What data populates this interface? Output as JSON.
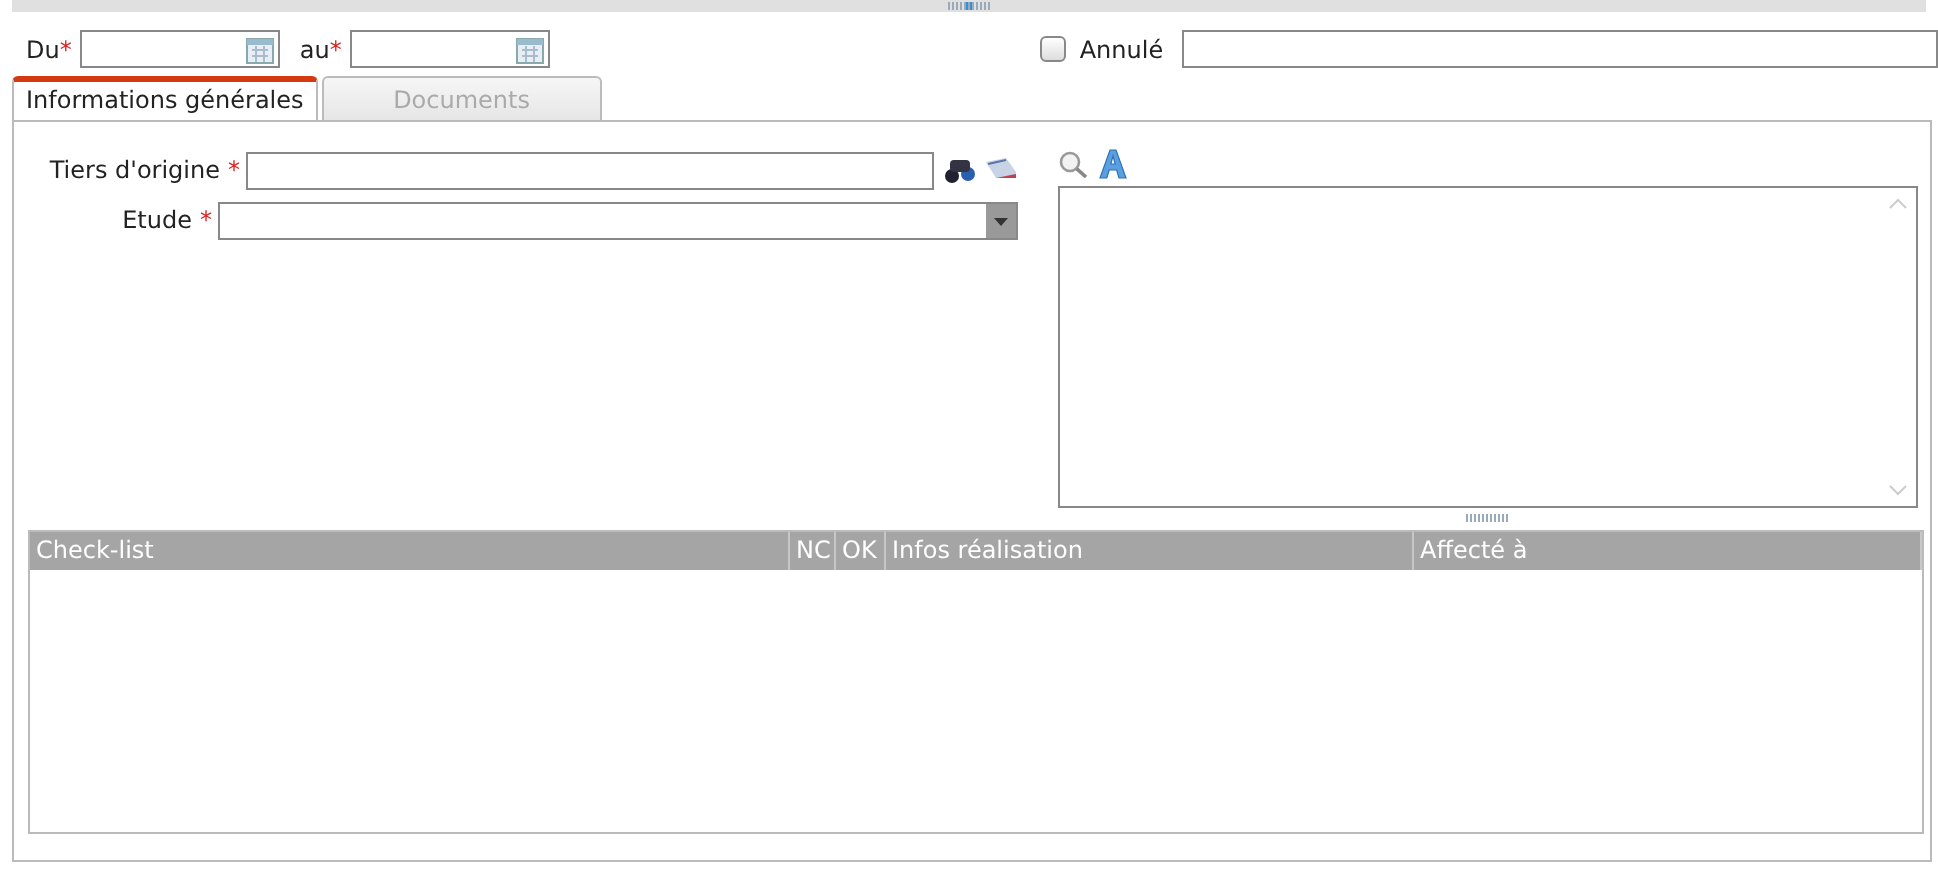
{
  "dates": [
    {
      "label": "Du",
      "required_mark": "*"
    },
    {
      "label": "au",
      "required_mark": "*"
    }
  ],
  "cancelled": {
    "label": "Annulé",
    "checked": false
  },
  "tabs": [
    {
      "label": "Informations générales",
      "selected": true
    },
    {
      "label": "Documents",
      "selected": false
    }
  ],
  "fields": [
    {
      "kind": "lookup",
      "label": "Tiers d'origine",
      "required_mark": "*"
    },
    {
      "kind": "select",
      "label": "Etude",
      "required_mark": "*"
    }
  ],
  "table": {
    "columns": [
      "Check-list",
      "NC",
      "OK",
      "Infos réalisation",
      "Affecté à"
    ]
  }
}
